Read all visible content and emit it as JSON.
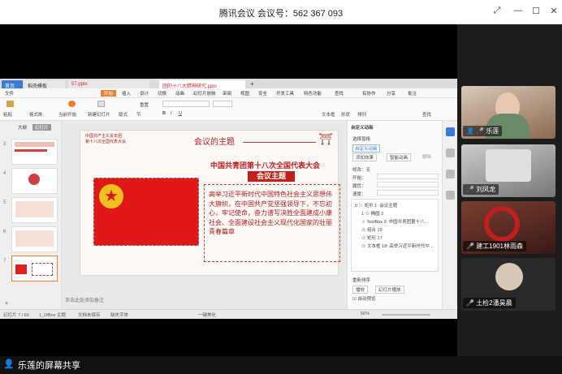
{
  "meeting": {
    "title": "腾讯会议 会议号：562 367 093"
  },
  "participants": [
    {
      "name": "乐莲"
    },
    {
      "name": "刘凤龙"
    },
    {
      "name": "建工1901林雨森"
    },
    {
      "name": "土检2潘昊晨"
    }
  ],
  "share": {
    "label": "乐莲的屏幕共享"
  },
  "tabs": {
    "home": "首页",
    "t1": "稻壳模板",
    "t2": "57.pptx",
    "t3": "团的十八大精神研究.pptx"
  },
  "menu": {
    "file": "文件",
    "start": "开始",
    "insert": "插入",
    "design": "设计",
    "switch": "切换",
    "anim": "动画",
    "show": "幻灯片放映",
    "review": "审阅",
    "view": "视图",
    "security": "安全",
    "dev": "开发工具",
    "special": "特色功能",
    "search": "查找",
    "collab": "有协作",
    "share": "分享",
    "annot": "批注"
  },
  "ribbon": {
    "paste": "粘贴",
    "format": "格式刷",
    "from_current": "当前开始",
    "new_slide": "新建幻灯片",
    "layout": "版式",
    "section": "节",
    "reset": "重置",
    "textbox": "文本框",
    "shape": "形状",
    "arrange": "排列",
    "find": "查找"
  },
  "thumb_tabs": {
    "outline": "大纲",
    "slides": "幻灯片"
  },
  "slide": {
    "header_line1": "中国共产主义青年团",
    "header_line2": "第十八次全国代表大会",
    "topic": "会议的主题",
    "headline": "中国共青团第十八次全国代表大会",
    "subhead": "会议主题",
    "body": "高举习近平新时代中国特色社会主义思想伟大旗帜，在中国共产党坚强领导下，不忘初心，牢记使命，奋力谱写决胜全面建成小康社会、全面建设社会主义现代化国家的壮丽青春篇章"
  },
  "notes_hint": "单击此处添加备注",
  "animation": {
    "panel_title": "自定义动画",
    "select_pane": "选择窗格",
    "custom_anim": "自定义动画",
    "add_effect": "添加效果",
    "smart_anim": "智能动画",
    "delete": "删除",
    "modify": "修改：无",
    "start": "开始：",
    "property": "属性：",
    "speed": "速度：",
    "items": [
      "0 ▷ 矩形 1: 会议主题",
      "1 ☆ 椭圆 2",
      "☆ TextBox 3: 中国共青团第十八…",
      "☆ 组合 19",
      "☆ 矩形 17",
      "☆ 文本框 18: 高举习近平新时代中…"
    ],
    "reorder": "重新排序",
    "play": "播放",
    "show": "幻灯片播放",
    "auto_preview": "自动预览"
  },
  "status": {
    "slide_no": "幻灯片 7 / 60",
    "theme": "1_Office 主题",
    "backup": "文档未保存",
    "font": "缺失字体",
    "notes": "一键美化",
    "zoom": "56%"
  }
}
